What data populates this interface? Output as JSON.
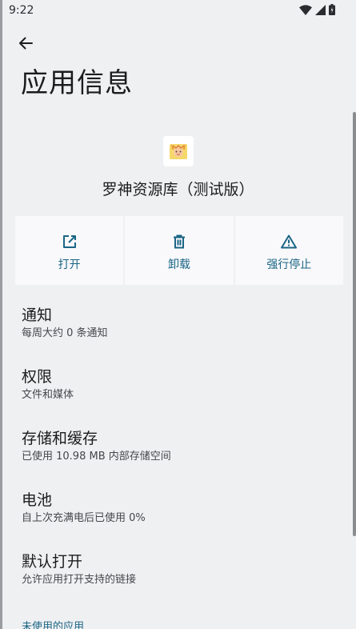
{
  "status_bar": {
    "time": "9:22",
    "icons": [
      "wifi-icon",
      "signal-icon",
      "battery-icon"
    ]
  },
  "header": {
    "back_icon": "arrow-back-icon",
    "title": "应用信息"
  },
  "app": {
    "icon": "app-icon",
    "name": "罗神资源库（测试版）"
  },
  "actions": [
    {
      "label": "打开",
      "icon": "open-external-icon"
    },
    {
      "label": "卸载",
      "icon": "trash-icon"
    },
    {
      "label": "强行停止",
      "icon": "warning-icon"
    }
  ],
  "settings": [
    {
      "title": "通知",
      "summary": "每周大约 0 条通知"
    },
    {
      "title": "权限",
      "summary": "文件和媒体"
    },
    {
      "title": "存储和缓存",
      "summary": "已使用 10.98 MB 内部存储空间"
    },
    {
      "title": "电池",
      "summary": "自上次充满电后已使用 0%"
    },
    {
      "title": "默认打开",
      "summary": "允许应用打开支持的链接"
    }
  ],
  "section_header": "未使用的应用",
  "colors": {
    "background": "#eff0f2",
    "accent": "#1a6585",
    "card": "#f9f9fb"
  }
}
